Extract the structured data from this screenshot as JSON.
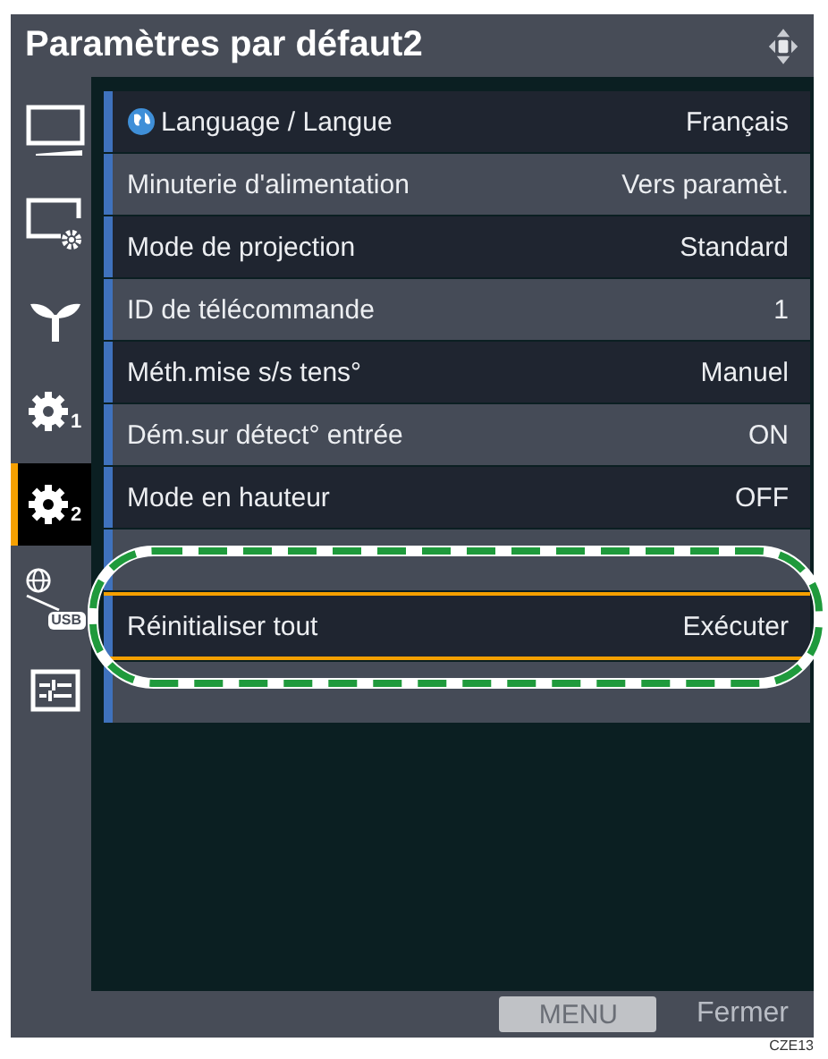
{
  "window": {
    "title": "Paramètres par défaut2"
  },
  "sidebar": {
    "items": [
      {
        "kind": "monitor",
        "selected": false
      },
      {
        "kind": "monitor-gear",
        "selected": false
      },
      {
        "kind": "sprout",
        "selected": false
      },
      {
        "kind": "gear",
        "sub": "1",
        "selected": false
      },
      {
        "kind": "gear",
        "sub": "2",
        "selected": true
      },
      {
        "kind": "network-usb",
        "sub": "USB",
        "selected": false
      },
      {
        "kind": "panel",
        "selected": false
      }
    ]
  },
  "rows": [
    {
      "label": "Language / Langue",
      "value": "Français",
      "globe": true,
      "selected": false
    },
    {
      "label": "Minuterie d'alimentation",
      "value": "Vers paramèt.",
      "selected": false
    },
    {
      "label": "Mode de projection",
      "value": "Standard",
      "selected": false
    },
    {
      "label": "ID de télécommande",
      "value": "1",
      "selected": false
    },
    {
      "label": "Méth.mise s/s tens°",
      "value": "Manuel",
      "selected": false
    },
    {
      "label": "Dém.sur détect° entrée",
      "value": "ON",
      "selected": false
    },
    {
      "label": "Mode en hauteur",
      "value": "OFF",
      "selected": false
    },
    {
      "selected": false
    },
    {
      "label": "Réinitialiser tout",
      "value": "Exécuter",
      "selected": true
    },
    {
      "selected": false
    }
  ],
  "footer": {
    "menu_button": "MENU",
    "close_label": "Fermer"
  },
  "figure_code": "CZE13"
}
